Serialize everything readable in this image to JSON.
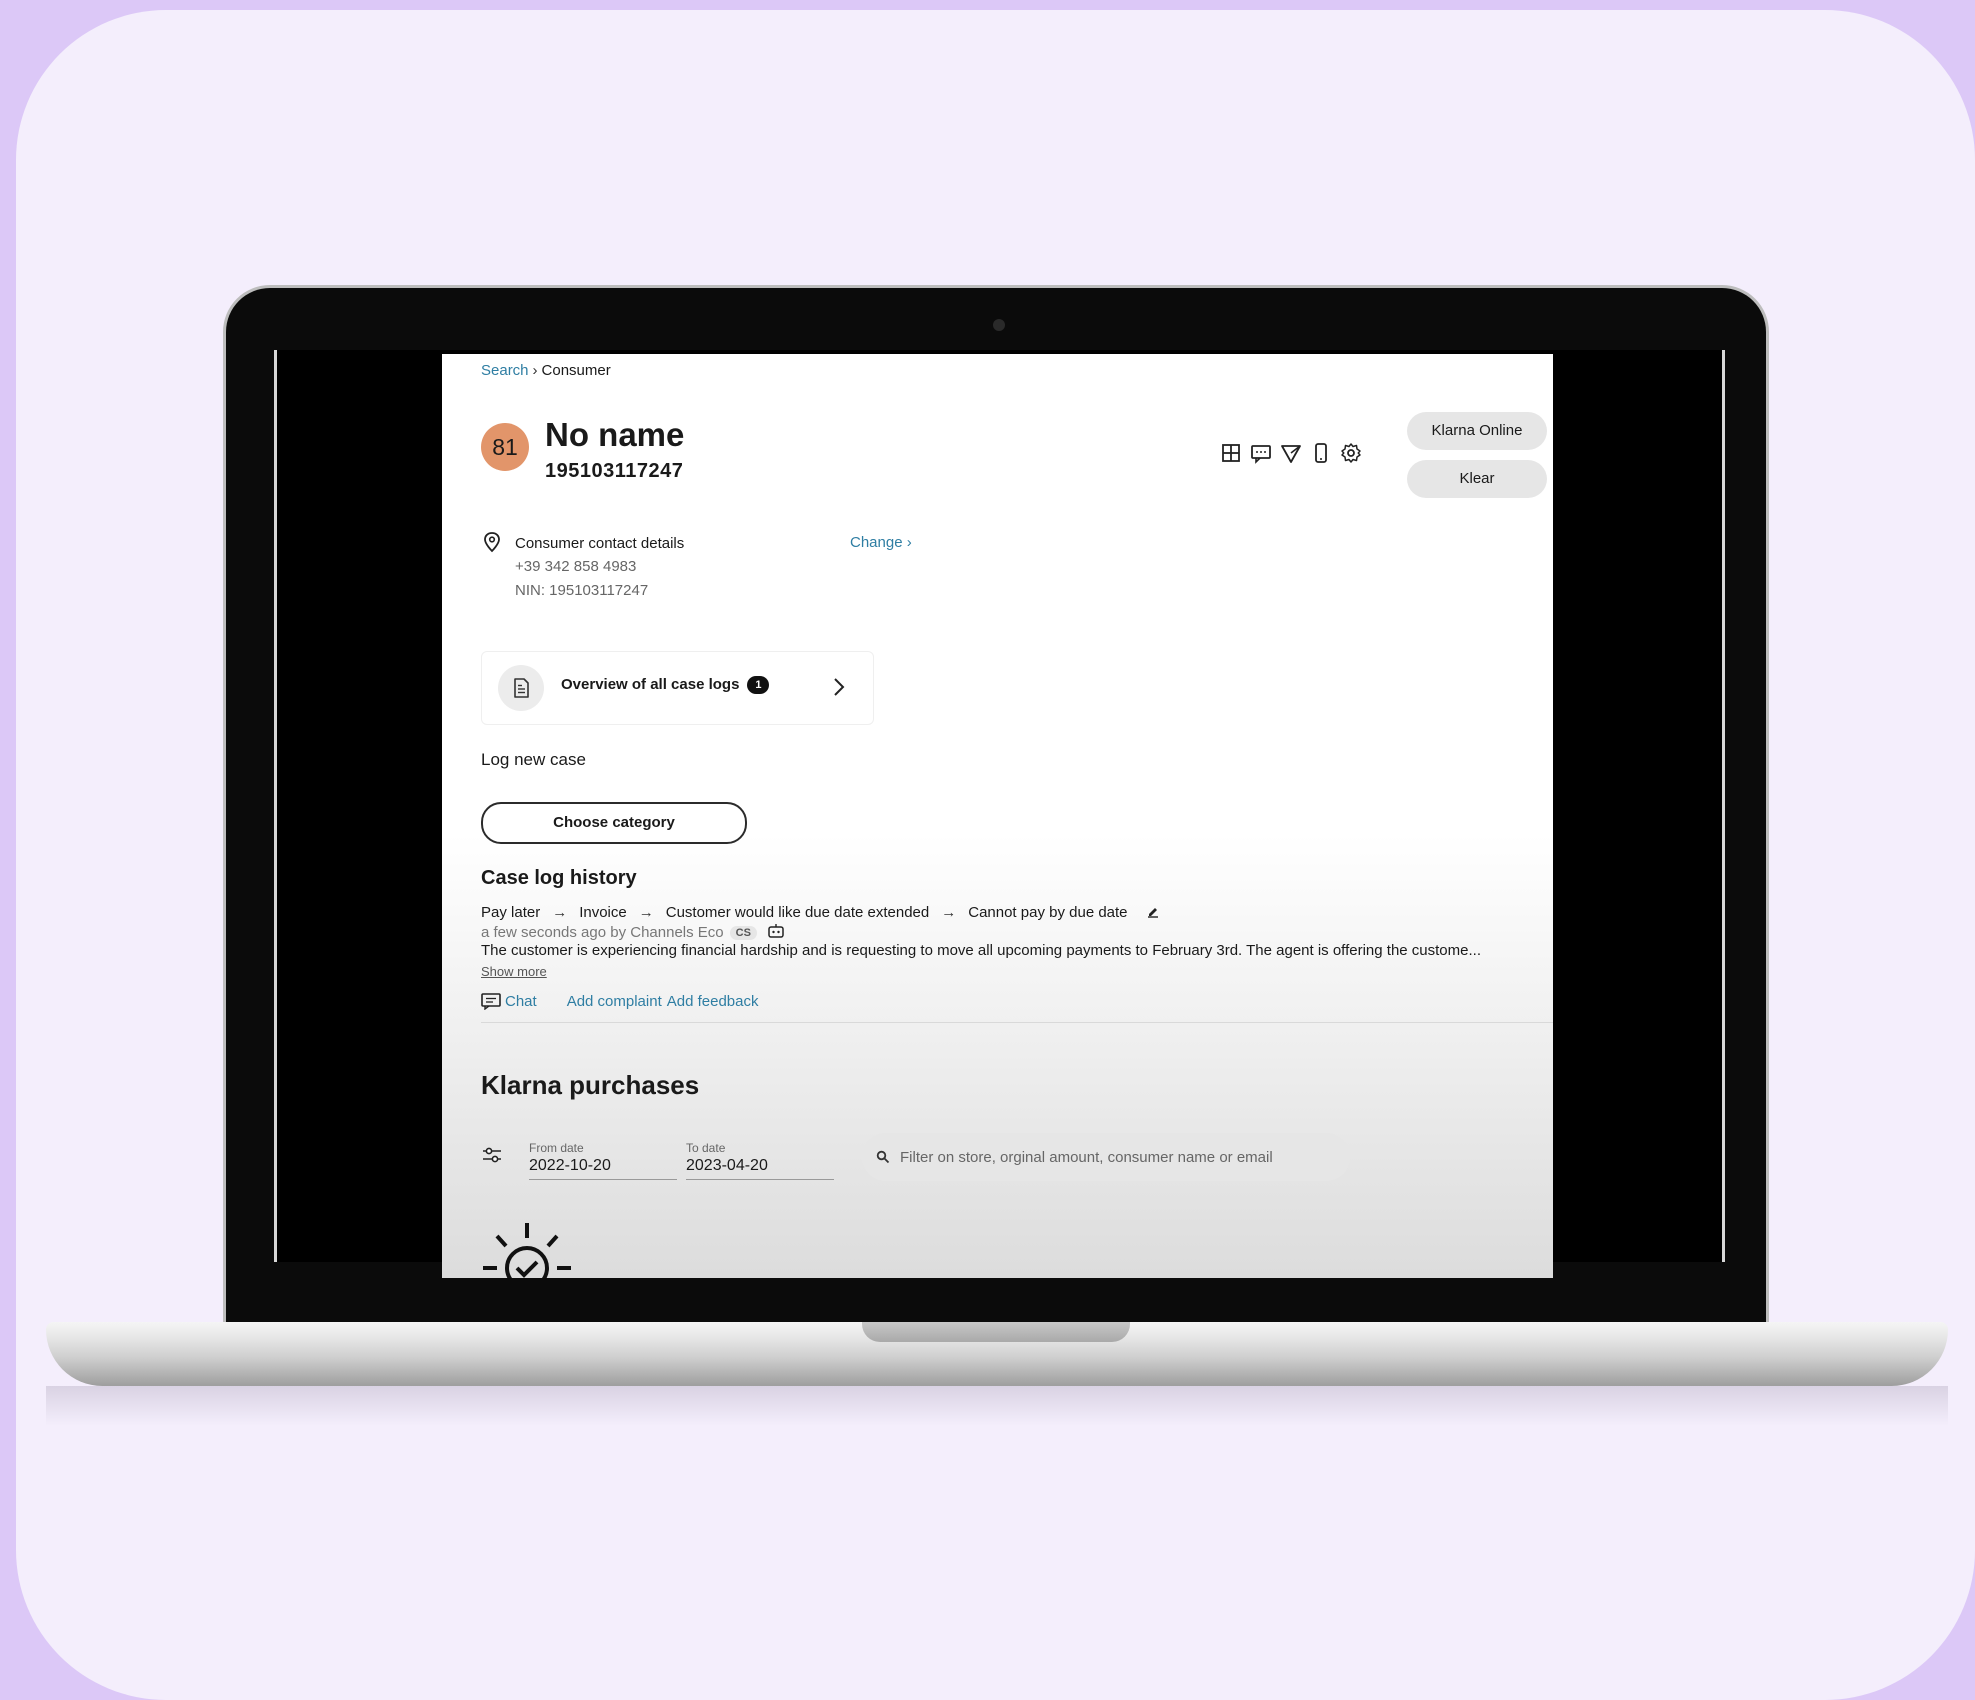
{
  "breadcrumb": {
    "link": "Search",
    "current": "Consumer"
  },
  "consumer": {
    "score": "81",
    "name": "No name",
    "id": "195103117247"
  },
  "top_buttons": {
    "klarna_online": "Klarna Online",
    "klear": "Klear"
  },
  "contact": {
    "title": "Consumer contact details",
    "phone": "+39 342 858 4983",
    "nin": "NIN: 195103117247",
    "change_label": "Change ›"
  },
  "overview": {
    "label": "Overview of all case logs",
    "count": "1"
  },
  "log_new_case": {
    "label": "Log new case",
    "button": "Choose category"
  },
  "case_log_history": {
    "title": "Case log history",
    "path": [
      "Pay later",
      "Invoice",
      "Customer would like due date extended",
      "Cannot pay by due date"
    ],
    "meta": "a few seconds ago by Channels Eco",
    "badge": "CS",
    "summary": "The customer is experiencing financial hardship and is requesting to move all upcoming payments to February 3rd. The agent is offering the custome...",
    "show_more": "Show more",
    "actions": {
      "chat": "Chat",
      "add_complaint": "Add complaint",
      "add_feedback": "Add feedback"
    }
  },
  "purchases": {
    "title": "Klarna purchases",
    "from_label": "From date",
    "from_value": "2022-10-20",
    "to_label": "To date",
    "to_value": "2023-04-20",
    "search_placeholder": "Filter on store, orginal amount, consumer name or email"
  },
  "icons": [
    "grid-icon",
    "message-icon",
    "send-icon",
    "phone-icon",
    "settings-icon",
    "location-pin-icon",
    "document-icon",
    "chevron-right-icon",
    "edit-icon",
    "robot-icon",
    "chat-icon",
    "filter-sliders-icon",
    "search-icon",
    "sun-check-icon"
  ],
  "colors": {
    "accent_link": "#2f7ea3",
    "avatar": "#e2956a",
    "page_background": "#f4eefc"
  }
}
